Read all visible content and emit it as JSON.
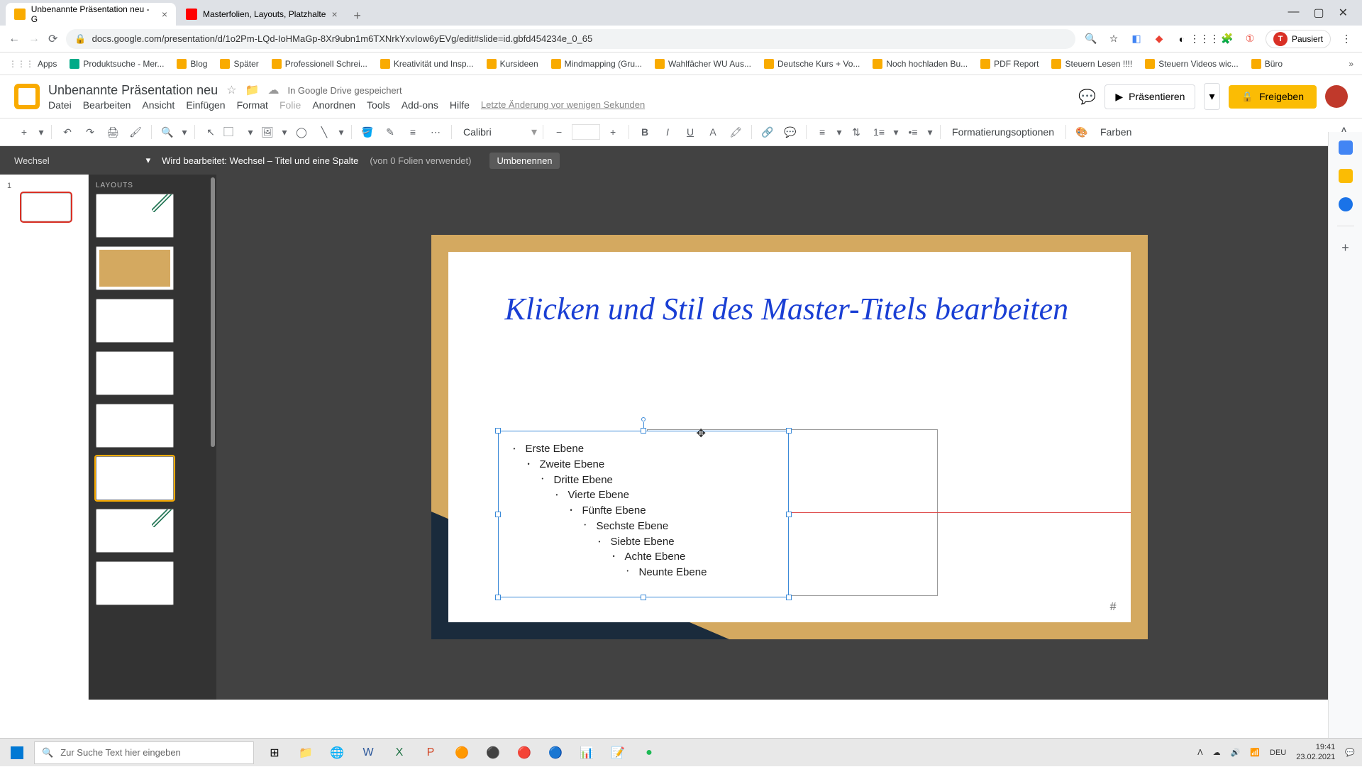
{
  "chrome": {
    "tabs": [
      {
        "title": "Unbenannte Präsentation neu - G"
      },
      {
        "title": "Masterfolien, Layouts, Platzhalte"
      }
    ],
    "url": "docs.google.com/presentation/d/1o2Pm-LQd-IoHMaGp-8Xr9ubn1m6TXNrkYxvIow6yEVg/edit#slide=id.gbfd454234e_0_65",
    "paused": "Pausiert",
    "bookmarks": [
      "Apps",
      "Produktsuche - Mer...",
      "Blog",
      "Später",
      "Professionell Schrei...",
      "Kreativität und Insp...",
      "Kursideen",
      "Mindmapping  (Gru...",
      "Wahlfächer WU Aus...",
      "Deutsche Kurs + Vo...",
      "Noch hochladen Bu...",
      "PDF Report",
      "Steuern Lesen !!!!",
      "Steuern Videos wic...",
      "Büro"
    ]
  },
  "doc": {
    "title": "Unbenannte Präsentation neu",
    "saved": "In Google Drive gespeichert",
    "menu": [
      "Datei",
      "Bearbeiten",
      "Ansicht",
      "Einfügen",
      "Format",
      "Folie",
      "Anordnen",
      "Tools",
      "Add-ons",
      "Hilfe"
    ],
    "lastEdit": "Letzte Änderung vor wenigen Sekunden",
    "present": "Präsentieren",
    "share": "Freigeben"
  },
  "toolbar": {
    "font": "Calibri",
    "formatOptions": "Formatierungsoptionen",
    "colors": "Farben"
  },
  "master": {
    "theme": "Wechsel",
    "layouts": "LAYOUTS",
    "editing": "Wird bearbeitet: Wechsel – Titel und eine Spalte",
    "usage": "(von 0 Folien verwendet)",
    "rename": "Umbenennen"
  },
  "slide": {
    "title": "Klicken und Stil des Master-Titels bearbeiten",
    "levels": [
      "Erste Ebene",
      "Zweite Ebene",
      "Dritte Ebene",
      "Vierte Ebene",
      "Fünfte Ebene",
      "Sechste Ebene",
      "Siebte Ebene",
      "Achte Ebene",
      "Neunte Ebene"
    ],
    "pageNum": "#"
  },
  "taskbar": {
    "search": "Zur Suche Text hier eingeben",
    "lang": "DEU",
    "time": "19:41",
    "date": "23.02.2021"
  }
}
